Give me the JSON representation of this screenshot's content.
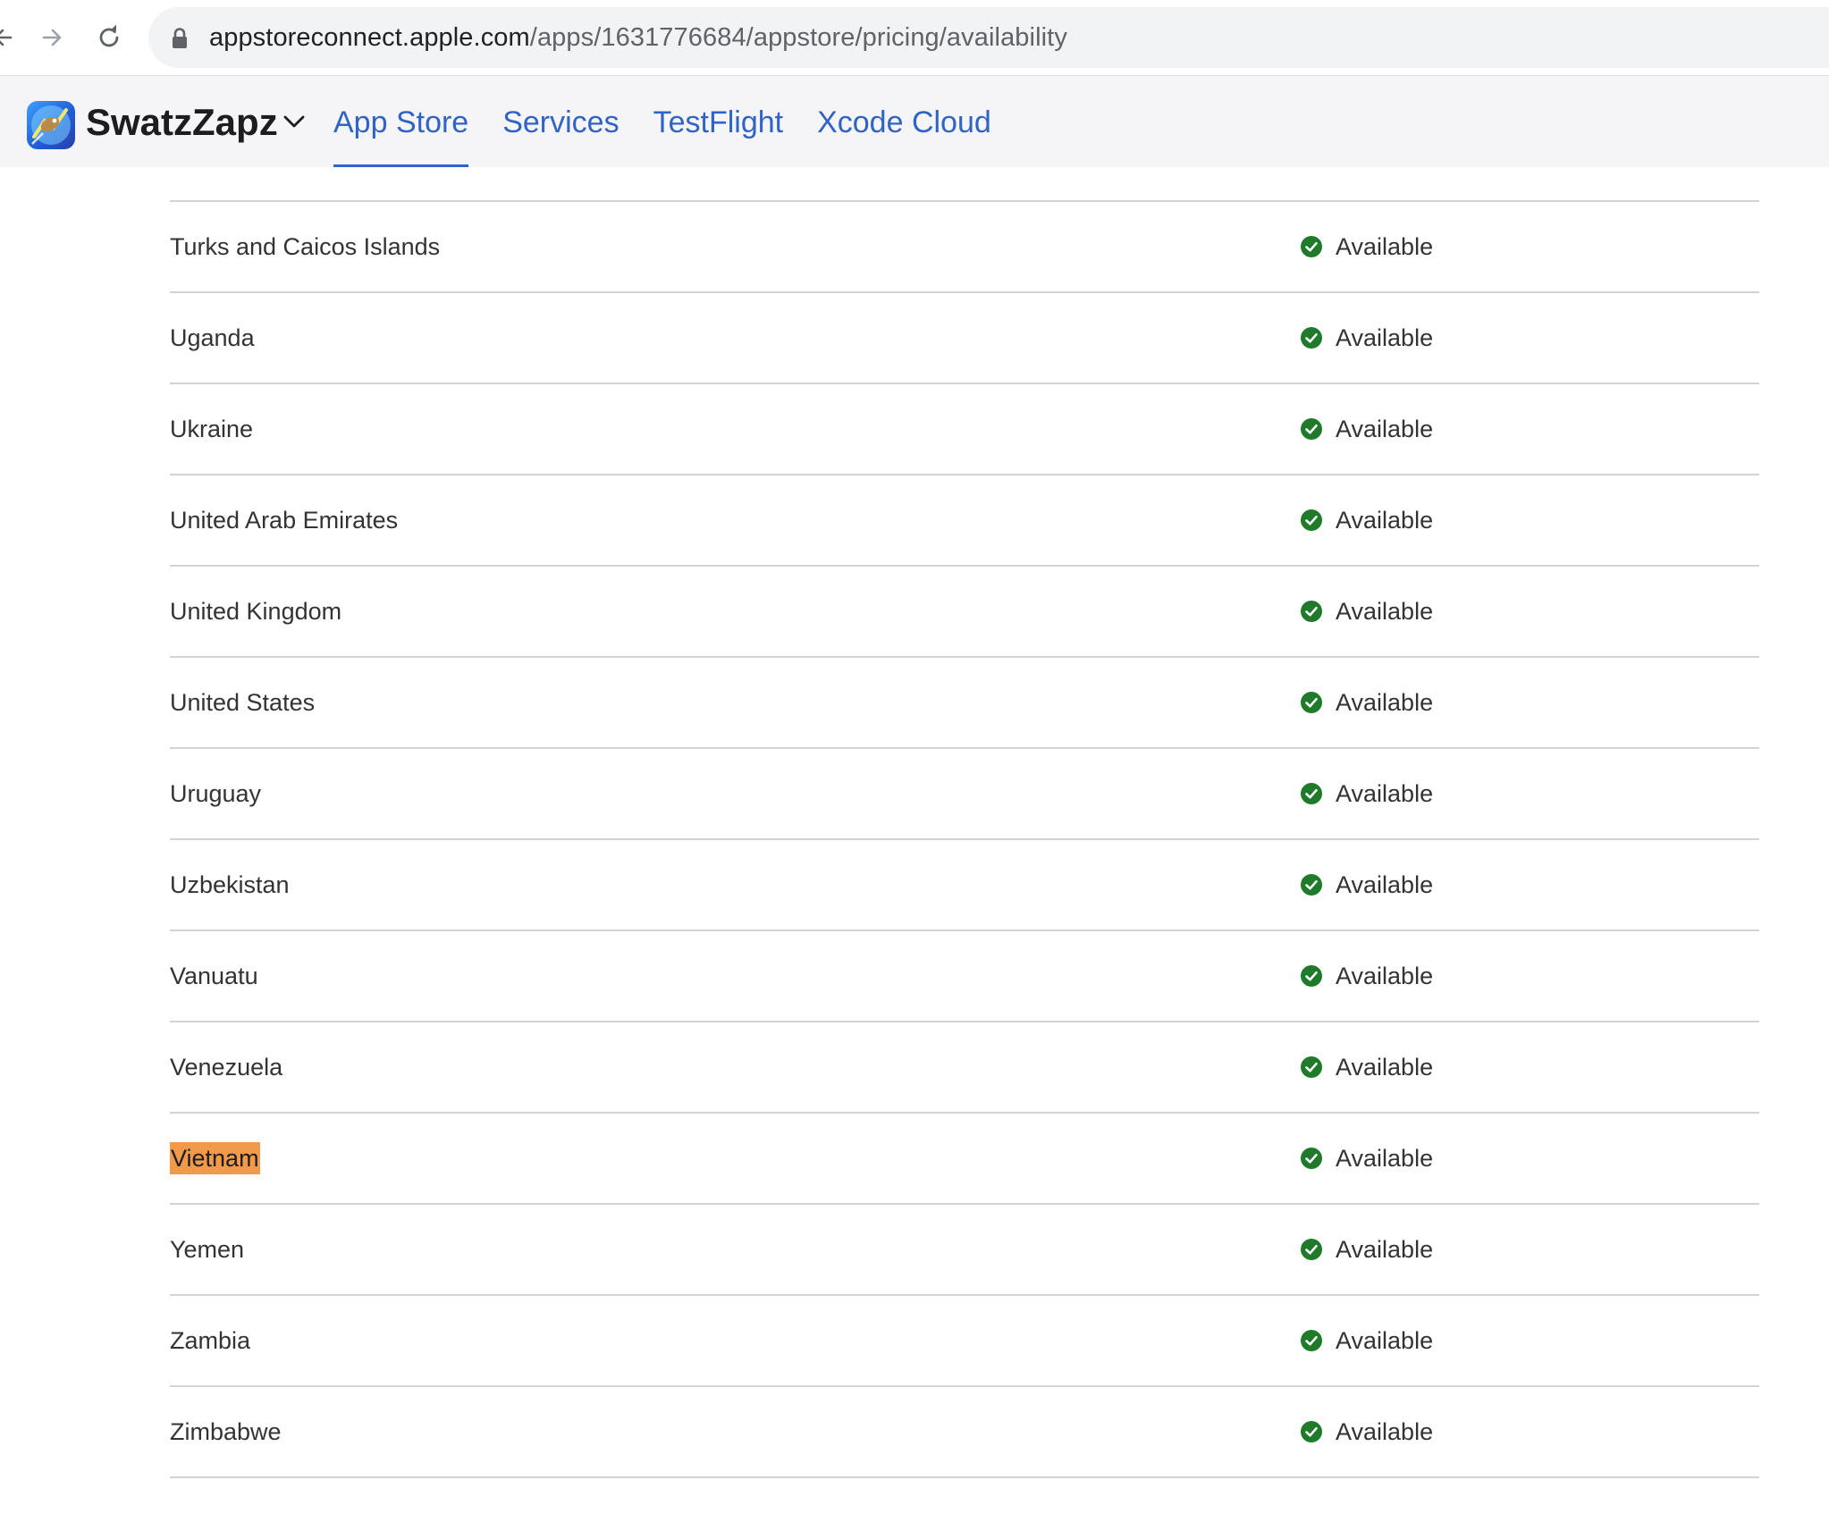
{
  "browser": {
    "url_host": "appstoreconnect.apple.com",
    "url_path": "/apps/1631776684/appstore/pricing/availability"
  },
  "app": {
    "name": "SwatzZapz"
  },
  "tabs": [
    {
      "label": "App Store",
      "active": true
    },
    {
      "label": "Services",
      "active": false
    },
    {
      "label": "TestFlight",
      "active": false
    },
    {
      "label": "Xcode Cloud",
      "active": false
    }
  ],
  "colors": {
    "link_blue": "#2f63c5",
    "available_green": "#1f7a2a",
    "highlight_orange": "#f29a4b"
  },
  "countries": [
    {
      "name": "Turks and Caicos Islands",
      "status": "Available",
      "highlighted": false
    },
    {
      "name": "Uganda",
      "status": "Available",
      "highlighted": false
    },
    {
      "name": "Ukraine",
      "status": "Available",
      "highlighted": false
    },
    {
      "name": "United Arab Emirates",
      "status": "Available",
      "highlighted": false
    },
    {
      "name": "United Kingdom",
      "status": "Available",
      "highlighted": false
    },
    {
      "name": "United States",
      "status": "Available",
      "highlighted": false
    },
    {
      "name": "Uruguay",
      "status": "Available",
      "highlighted": false
    },
    {
      "name": "Uzbekistan",
      "status": "Available",
      "highlighted": false
    },
    {
      "name": "Vanuatu",
      "status": "Available",
      "highlighted": false
    },
    {
      "name": "Venezuela",
      "status": "Available",
      "highlighted": false
    },
    {
      "name": "Vietnam",
      "status": "Available",
      "highlighted": true
    },
    {
      "name": "Yemen",
      "status": "Available",
      "highlighted": false
    },
    {
      "name": "Zambia",
      "status": "Available",
      "highlighted": false
    },
    {
      "name": "Zimbabwe",
      "status": "Available",
      "highlighted": false
    }
  ]
}
